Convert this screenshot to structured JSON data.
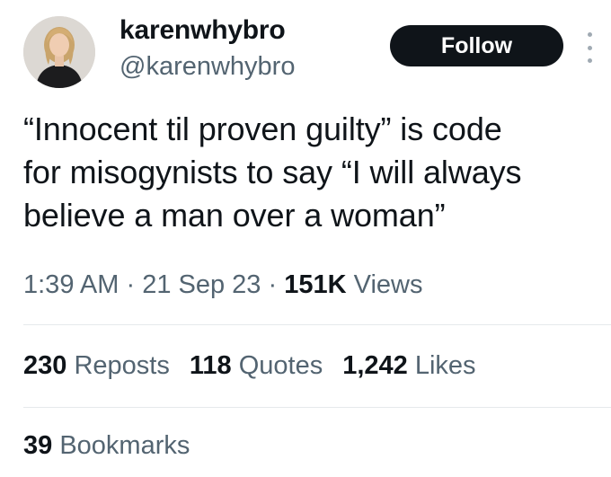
{
  "author": {
    "display_name": "karenwhybro",
    "handle": "@karenwhybro",
    "avatar_icon": "profile-photo"
  },
  "follow_button": {
    "label": "Follow"
  },
  "more_icon": "more-vertical-icon",
  "tweet": {
    "text": "“Innocent til proven guilty” is code\nfor misogynists to say “I will always\nbelieve a man over a woman”"
  },
  "meta": {
    "time": "1:39 AM",
    "date": "21 Sep 23",
    "separator": "·",
    "views_count": "151K",
    "views_label": "Views"
  },
  "stats": {
    "reposts": {
      "count": "230",
      "label": "Reposts"
    },
    "quotes": {
      "count": "118",
      "label": "Quotes"
    },
    "likes": {
      "count": "1,242",
      "label": "Likes"
    }
  },
  "bookmarks": {
    "count": "39",
    "label": "Bookmarks"
  },
  "colors": {
    "text_primary": "#0f1419",
    "text_secondary": "#536471",
    "button_bg": "#0f1419",
    "divider": "#e6e9ec"
  }
}
